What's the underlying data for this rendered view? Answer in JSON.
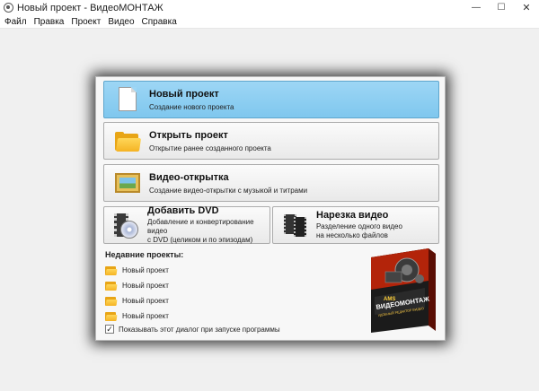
{
  "window": {
    "title": "Новый проект - ВидеоМОНТАЖ",
    "minimize_glyph": "—",
    "maximize_glyph": "☐",
    "close_glyph": "✕"
  },
  "menu": {
    "items": [
      "Файл",
      "Правка",
      "Проект",
      "Видео",
      "Справка"
    ]
  },
  "dialog": {
    "new_project": {
      "title": "Новый проект",
      "subtitle": "Создание нового проекта",
      "icon": "document-icon"
    },
    "open_project": {
      "title": "Открыть проект",
      "subtitle": "Открытие ранее созданного проекта",
      "icon": "folder-icon"
    },
    "video_card": {
      "title": "Видео-открытка",
      "subtitle": "Создание видео-открытки с музыкой и титрами",
      "icon": "picture-frame-icon"
    },
    "add_dvd": {
      "title": "Добавить DVD",
      "subtitle_line1": "Добавление и конвертирование видео",
      "subtitle_line2": "с DVD (целиком и по эпизодам)",
      "icon": "dvd-icon"
    },
    "cut_video": {
      "title": "Нарезка видео",
      "subtitle_line1": "Разделение одного видео",
      "subtitle_line2": "на несколько файлов",
      "icon": "film-strip-icon"
    },
    "recent_title": "Недавние проекты:",
    "recent_items": [
      "Новый проект",
      "Новый проект",
      "Новый проект",
      "Новый проект"
    ],
    "show_on_start_label": "Показывать этот диалог при запуске программы",
    "show_on_start_checked": true,
    "product_box": {
      "brand": "AMS",
      "name": "ВИДЕОМОНТАЖ",
      "tagline": "УДОБНЫЙ РЕДАКТОР ВИДЕО"
    }
  },
  "colors": {
    "active_button": "#8ecff2",
    "dialog_bg": "#f7f7f7",
    "workspace_bg": "#f0f0f0",
    "folder": "#f5b323"
  }
}
